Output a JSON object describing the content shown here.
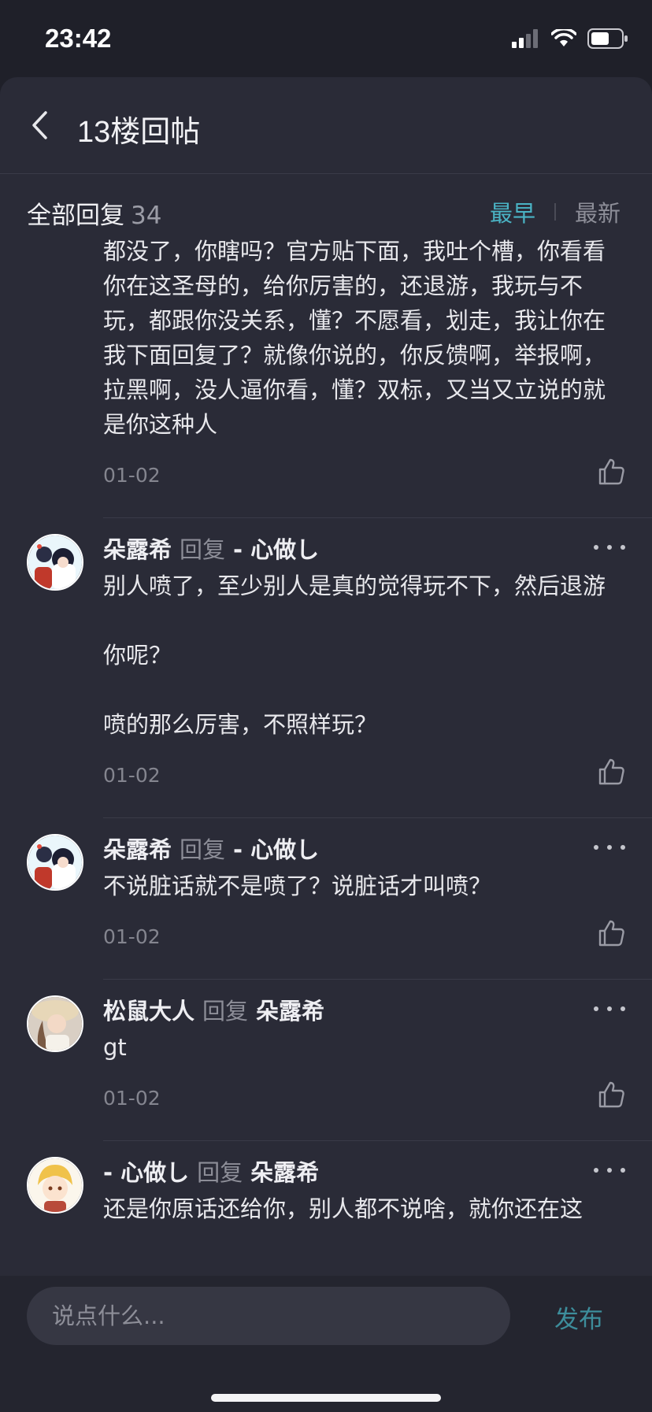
{
  "status_bar": {
    "time": "23:42"
  },
  "nav": {
    "title": "13楼回帖"
  },
  "sort": {
    "label": "全部回复",
    "count": "34",
    "earliest": "最早",
    "latest": "最新"
  },
  "replies": [
    {
      "text": "都没了，你瞎吗？官方贴下面，我吐个槽，你看看你在这圣母的，给你厉害的，还退游，我玩与不玩，都跟你没关系，懂？不愿看，划走，我让你在我下面回复了？就像你说的，你反馈啊，举报啊，拉黑啊，没人逼你看，懂？双标，又当又立说的就是你这种人",
      "date": "01-02"
    },
    {
      "name": "朵露希",
      "reply_word": "回复",
      "target": "-   心做し",
      "text": "别人喷了，至少别人是真的觉得玩不下，然后退游\n\n你呢？\n\n喷的那么厉害，不照样玩？",
      "date": "01-02"
    },
    {
      "name": "朵露希",
      "reply_word": "回复",
      "target": "-   心做し",
      "text": "不说脏话就不是喷了？说脏话才叫喷？",
      "date": "01-02"
    },
    {
      "name": "松鼠大人",
      "reply_word": "回复",
      "target": "朵露希",
      "text": "gt",
      "date": "01-02"
    },
    {
      "name": "-   心做し",
      "reply_word": "回复",
      "target": "朵露希",
      "text": "还是你原话还给你，别人都不说啥，就你还在这"
    }
  ],
  "input": {
    "placeholder": "说点什么..."
  },
  "publish_label": "发布",
  "colors": {
    "accent": "#4ab3c4",
    "background": "#2a2b37",
    "publish": "#3d8d9b"
  }
}
